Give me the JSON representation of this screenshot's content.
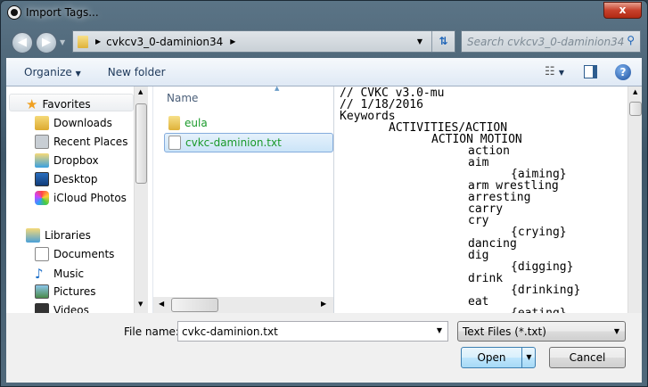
{
  "window": {
    "title": "Import Tags...",
    "close_label": "x"
  },
  "address": {
    "path": "cvkcv3_0-daminion34",
    "search_placeholder": "Search cvkcv3_0-daminion34"
  },
  "toolbar": {
    "organize": "Organize",
    "new_folder": "New folder"
  },
  "nav": {
    "favorites": "Favorites",
    "favorites_items": [
      "Downloads",
      "Recent Places",
      "Dropbox",
      "Desktop",
      "iCloud Photos"
    ],
    "libraries": "Libraries",
    "libraries_items": [
      "Documents",
      "Music",
      "Pictures",
      "Videos"
    ]
  },
  "files": {
    "column": "Name",
    "items": [
      {
        "name": "eula",
        "type": "folder"
      },
      {
        "name": "cvkc-daminion.txt",
        "type": "text",
        "selected": true
      }
    ],
    "text_color": "#1a9a2a"
  },
  "preview": {
    "lines": [
      {
        "t": "// CVKC v3.0-mu",
        "l": 0
      },
      {
        "t": "// 1/18/2016",
        "l": 0
      },
      {
        "t": "Keywords",
        "l": 0
      },
      {
        "t": "ACTIVITIES/ACTION",
        "l": 1
      },
      {
        "t": "ACTION MOTION",
        "l": 2
      },
      {
        "t": "action",
        "l": 3
      },
      {
        "t": "aim",
        "l": 3
      },
      {
        "t": "{aiming}",
        "l": 4
      },
      {
        "t": "arm wrestling",
        "l": 3
      },
      {
        "t": "arresting",
        "l": 3
      },
      {
        "t": "carry",
        "l": 3
      },
      {
        "t": "cry",
        "l": 3
      },
      {
        "t": "{crying}",
        "l": 4
      },
      {
        "t": "dancing",
        "l": 3
      },
      {
        "t": "dig",
        "l": 3
      },
      {
        "t": "{digging}",
        "l": 4
      },
      {
        "t": "drink",
        "l": 3
      },
      {
        "t": "{drinking}",
        "l": 4
      },
      {
        "t": "eat",
        "l": 3
      },
      {
        "t": "{eating}",
        "l": 4
      }
    ]
  },
  "bottom": {
    "file_name_label": "File name:",
    "file_name_value": "cvkc-daminion.txt",
    "file_type": "Text Files (*.txt)",
    "open": "Open",
    "cancel": "Cancel"
  }
}
